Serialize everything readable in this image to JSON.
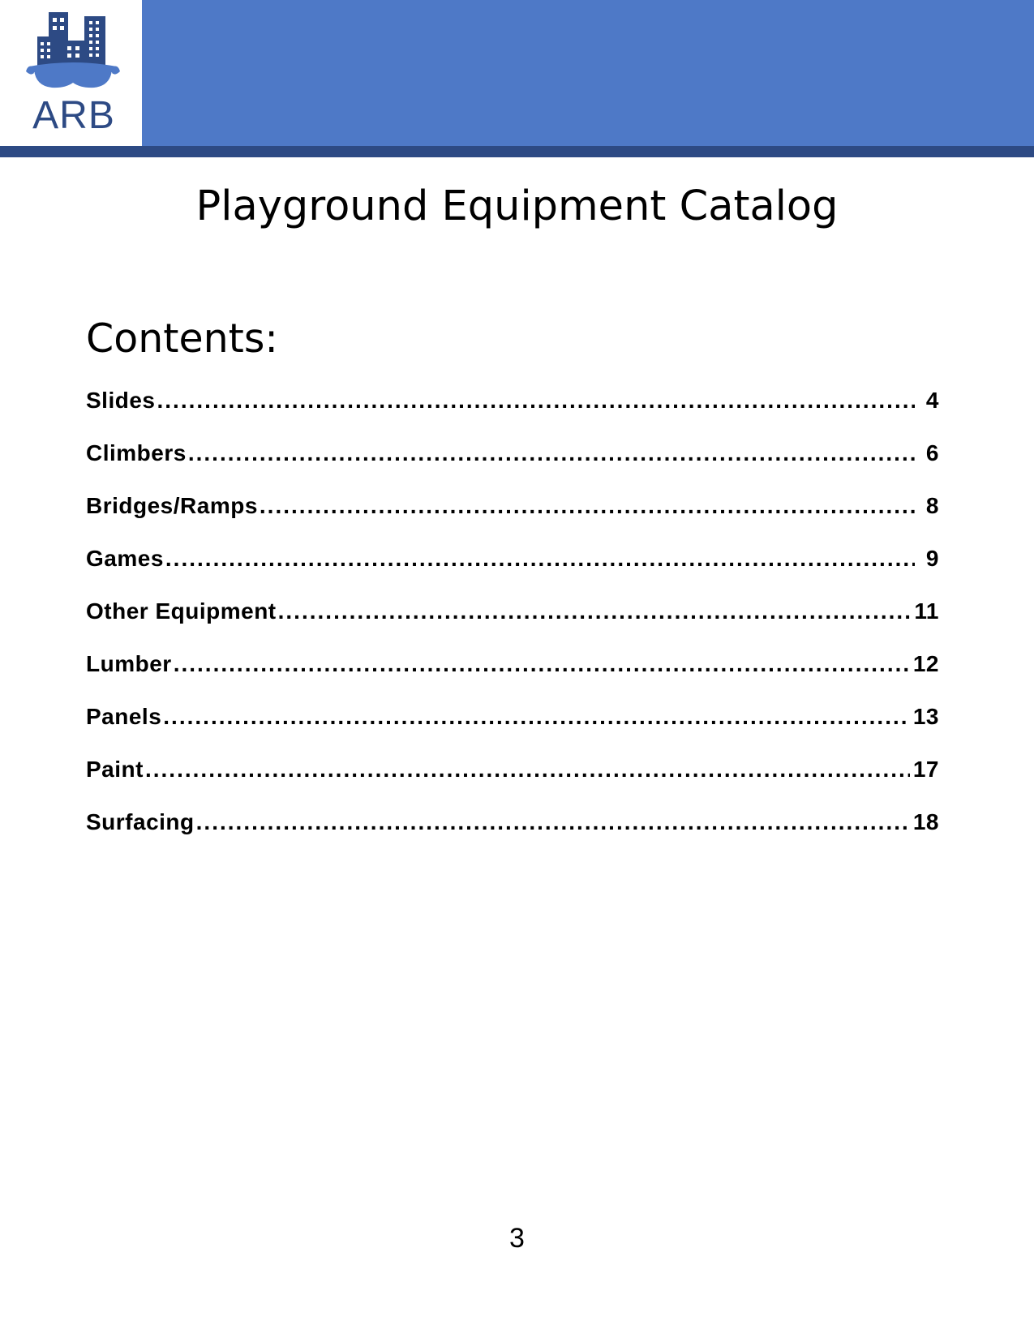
{
  "header": {
    "logo_text": "ARB",
    "band_color": "#4e79c7",
    "rule_color": "#2d4a84",
    "logo_color": "#2d4a84",
    "logo_icon": "city-buildings-goggles-icon"
  },
  "title": "Playground Equipment Catalog",
  "contents": {
    "heading": "Contents:",
    "items": [
      {
        "label": "Slides",
        "page": "4"
      },
      {
        "label": "Climbers",
        "page": "6"
      },
      {
        "label": "Bridges/Ramps",
        "page": "8"
      },
      {
        "label": "Games",
        "page": "9"
      },
      {
        "label": "Other Equipment",
        "page": "11"
      },
      {
        "label": "Lumber",
        "page": "12"
      },
      {
        "label": "Panels",
        "page": "13"
      },
      {
        "label": "Paint",
        "page": "17"
      },
      {
        "label": "Surfacing",
        "page": "18"
      }
    ]
  },
  "footer": {
    "page_number": "3"
  }
}
